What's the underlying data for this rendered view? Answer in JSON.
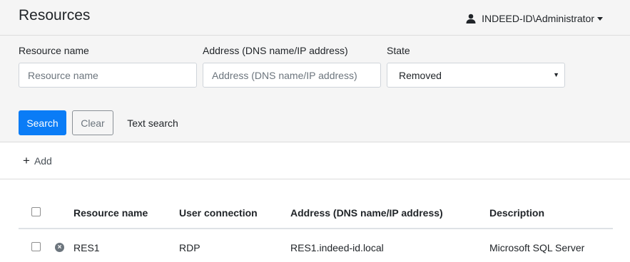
{
  "header": {
    "title": "Resources",
    "user_label": "INDEED-ID\\Administrator",
    "user_icon": "user-icon"
  },
  "filters": {
    "resource_name": {
      "label": "Resource name",
      "placeholder": "Resource name",
      "value": ""
    },
    "address": {
      "label": "Address (DNS name/IP address)",
      "placeholder": "Address (DNS name/IP address)",
      "value": ""
    },
    "state": {
      "label": "State",
      "selected": "Removed"
    }
  },
  "actions": {
    "search_label": "Search",
    "clear_label": "Clear",
    "text_search_label": "Text search"
  },
  "toolbar": {
    "add_label": "Add"
  },
  "table": {
    "columns": [
      "Resource name",
      "User connection",
      "Address (DNS name/IP address)",
      "Description"
    ],
    "rows": [
      {
        "name": "RES1",
        "connection": "RDP",
        "address": "RES1.indeed-id.local",
        "description": "Microsoft SQL Server"
      }
    ]
  },
  "colors": {
    "primary": "#0a7cf6",
    "panel_bg": "#f5f5f5"
  }
}
